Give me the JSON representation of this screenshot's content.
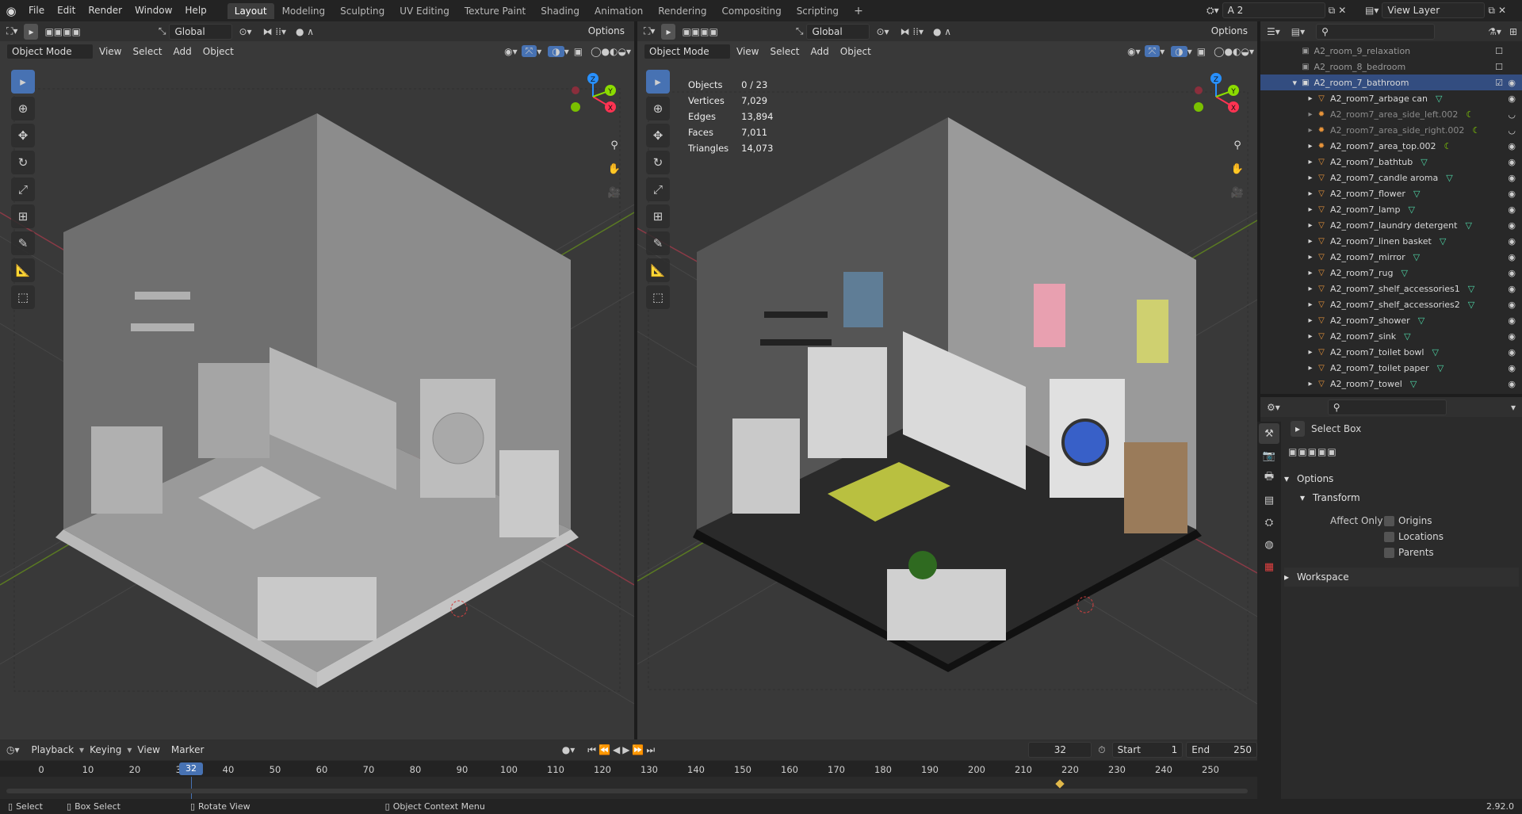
{
  "menu": [
    "File",
    "Edit",
    "Render",
    "Window",
    "Help"
  ],
  "workspace_tabs": [
    "Layout",
    "Modeling",
    "Sculpting",
    "UV Editing",
    "Texture Paint",
    "Shading",
    "Animation",
    "Rendering",
    "Compositing",
    "Scripting"
  ],
  "active_tab": "Layout",
  "scene_name": "A 2",
  "view_layer": "View Layer",
  "header": {
    "transform_orientation": "Global",
    "options": "Options",
    "mode": "Object Mode",
    "view": "View",
    "select": "Select",
    "add": "Add",
    "object": "Object"
  },
  "stats": [
    {
      "label": "Objects",
      "value": "0 / 23"
    },
    {
      "label": "Vertices",
      "value": "7,029"
    },
    {
      "label": "Edges",
      "value": "13,894"
    },
    {
      "label": "Faces",
      "value": "7,011"
    },
    {
      "label": "Triangles",
      "value": "14,073"
    }
  ],
  "gizmo": {
    "x": "X",
    "y": "Y",
    "z": "Z"
  },
  "outliner": {
    "collections": [
      "A2_room_9_relaxation",
      "A2_room_8_bedroom",
      "A2_room_7_bathroom"
    ],
    "objects": [
      {
        "name": "A2_room7_arbage can",
        "type": "mesh"
      },
      {
        "name": "A2_room7_area_side_left.002",
        "type": "light"
      },
      {
        "name": "A2_room7_area_side_right.002",
        "type": "light"
      },
      {
        "name": "A2_room7_area_top.002",
        "type": "light"
      },
      {
        "name": "A2_room7_bathtub",
        "type": "mesh"
      },
      {
        "name": "A2_room7_candle aroma",
        "type": "mesh"
      },
      {
        "name": "A2_room7_flower",
        "type": "mesh"
      },
      {
        "name": "A2_room7_lamp",
        "type": "mesh"
      },
      {
        "name": "A2_room7_laundry detergent",
        "type": "mesh"
      },
      {
        "name": "A2_room7_linen basket",
        "type": "mesh"
      },
      {
        "name": "A2_room7_mirror",
        "type": "mesh"
      },
      {
        "name": "A2_room7_rug",
        "type": "mesh"
      },
      {
        "name": "A2_room7_shelf_accessories1",
        "type": "mesh"
      },
      {
        "name": "A2_room7_shelf_accessories2",
        "type": "mesh"
      },
      {
        "name": "A2_room7_shower",
        "type": "mesh"
      },
      {
        "name": "A2_room7_sink",
        "type": "mesh"
      },
      {
        "name": "A2_room7_toilet bowl",
        "type": "mesh"
      },
      {
        "name": "A2_room7_toilet paper",
        "type": "mesh"
      },
      {
        "name": "A2_room7_towel",
        "type": "mesh"
      }
    ]
  },
  "properties": {
    "tool_name": "Select Box",
    "options": "Options",
    "transform": "Transform",
    "affect_only": "Affect Only",
    "origins": "Origins",
    "locations": "Locations",
    "parents": "Parents",
    "workspace": "Workspace"
  },
  "timeline": {
    "playback": "Playback",
    "keying": "Keying",
    "view": "View",
    "marker": "Marker",
    "current_frame": "32",
    "start_label": "Start",
    "start": "1",
    "end_label": "End",
    "end": "250",
    "ticks": [
      "0",
      "10",
      "20",
      "30",
      "40",
      "50",
      "60",
      "70",
      "80",
      "90",
      "100",
      "110",
      "120",
      "130",
      "140",
      "150",
      "160",
      "170",
      "180",
      "190",
      "200",
      "210",
      "220",
      "230",
      "240",
      "250"
    ],
    "keyframe": 220
  },
  "status": {
    "select": "Select",
    "box_select": "Box Select",
    "rotate_view": "Rotate View",
    "context_menu": "Object Context Menu",
    "version": "2.92.0"
  },
  "colors": {
    "accent": "#4772b3",
    "x_axis": "#ff3352",
    "y_axis": "#8bdc00",
    "z_axis": "#2890ff",
    "selected_row": "#334d80"
  }
}
